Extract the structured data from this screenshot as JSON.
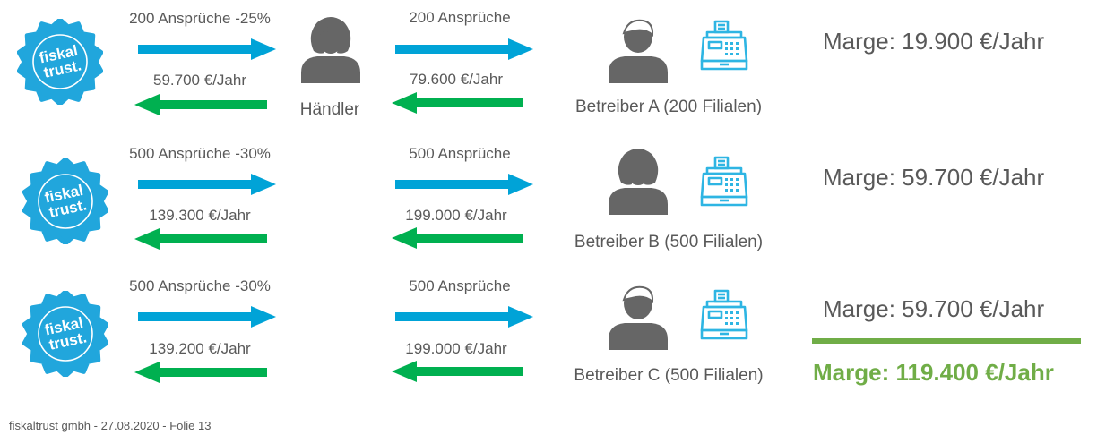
{
  "rows": [
    {
      "top_left": "200 Ansprüche  -25%",
      "bottom_left": "59.700 €/Jahr",
      "top_right": "200 Ansprüche",
      "bottom_right": "79.600 €/Jahr",
      "betreiber": "Betreiber A (200 Filialen)",
      "betreiber_icon": "male-person-icon",
      "marge": "Marge: 19.900 €/Jahr"
    },
    {
      "top_left": "500 Ansprüche  -30%",
      "bottom_left": "139.300 €/Jahr",
      "top_right": "500 Ansprüche",
      "bottom_right": "199.000 €/Jahr",
      "betreiber": "Betreiber B (500 Filialen)",
      "betreiber_icon": "female-person-icon",
      "marge": "Marge: 59.700 €/Jahr"
    },
    {
      "top_left": "500 Ansprüche  -30%",
      "bottom_left": "139.200 €/Jahr",
      "top_right": "500 Ansprüche",
      "bottom_right": "199.000 €/Jahr",
      "betreiber": "Betreiber C (500 Filialen)",
      "betreiber_icon": "male-person-icon",
      "marge": "Marge: 59.700 €/Jahr"
    }
  ],
  "haendler": {
    "label": "Händler",
    "icon": "female-person-icon"
  },
  "logo": {
    "line1": "fiskal",
    "line2": "trust."
  },
  "total": {
    "label": "Marge: 119.400 €/Jahr",
    "color": "#70ad47"
  },
  "footer": "fiskaltrust gmbh - 27.08.2020 - Folie 13",
  "colors": {
    "blue_arrow": "#00a3d7",
    "green_arrow": "#00b050",
    "icon_gray": "#666666",
    "register_blue": "#2eb5e3",
    "badge": "#21a6dc"
  }
}
